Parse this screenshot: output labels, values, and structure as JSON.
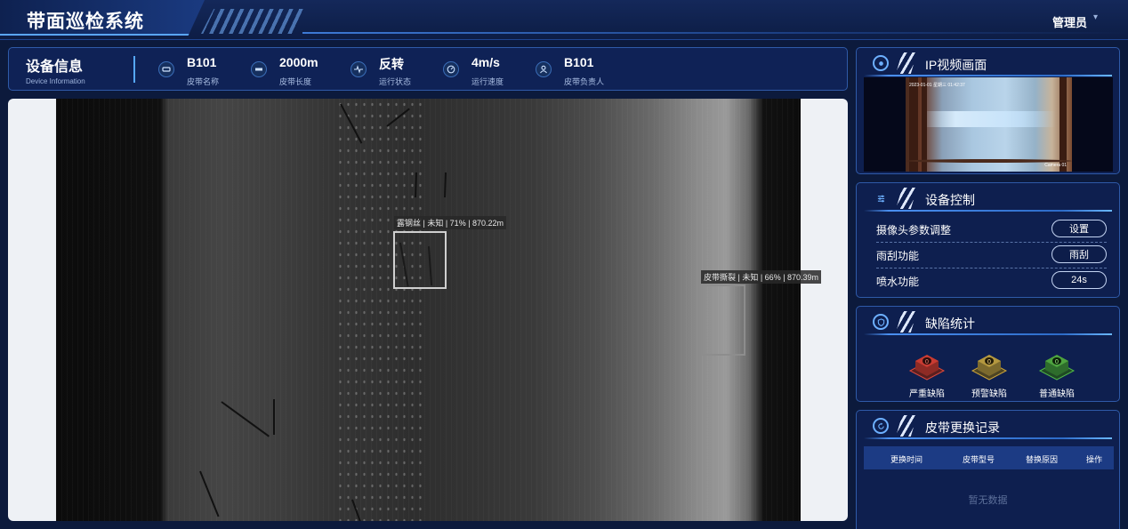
{
  "header": {
    "app_title": "带面巡检系统",
    "user": "管理员"
  },
  "device_info": {
    "title": "设备信息",
    "subtitle": "Device Information",
    "stats": [
      {
        "value": "B101",
        "label": "皮带名称",
        "icon": "belt-tag-icon"
      },
      {
        "value": "2000m",
        "label": "皮带长度",
        "icon": "ruler-icon"
      },
      {
        "value": "反转",
        "label": "运行状态",
        "icon": "pulse-icon"
      },
      {
        "value": "4m/s",
        "label": "运行速度",
        "icon": "speedometer-icon"
      },
      {
        "value": "B101",
        "label": "皮带负责人",
        "icon": "person-icon"
      }
    ]
  },
  "detections": [
    {
      "label": "露钢丝 | 未知 | 71% | 870.22m"
    },
    {
      "label": "皮带撕裂 | 未知 | 66% | 870.39m"
    }
  ],
  "video_panel": {
    "title": "IP视频画面",
    "timestamp": "2023-01-01 星期三 01:42:37",
    "camera": "Camera 01"
  },
  "control_panel": {
    "title": "设备控制",
    "rows": [
      {
        "label": "摄像头参数调整",
        "button": "设置"
      },
      {
        "label": "雨刮功能",
        "button": "雨刮"
      },
      {
        "label": "喷水功能",
        "button": "24s"
      }
    ]
  },
  "defect_panel": {
    "title": "缺陷统计",
    "items": [
      {
        "label": "严重缺陷",
        "count": "0",
        "color": "#d8473c"
      },
      {
        "label": "预警缺陷",
        "count": "0",
        "color": "#c9a23a"
      },
      {
        "label": "普通缺陷",
        "count": "0",
        "color": "#4fb548"
      }
    ]
  },
  "record_panel": {
    "title": "皮带更换记录",
    "columns": [
      "更换时间",
      "皮带型号",
      "替换原因",
      "操作"
    ],
    "empty_text": "暂无数据"
  },
  "colors": {
    "background": "#0c1a3c",
    "panel": "#0e1f4f",
    "accent": "#4a8ff0"
  }
}
